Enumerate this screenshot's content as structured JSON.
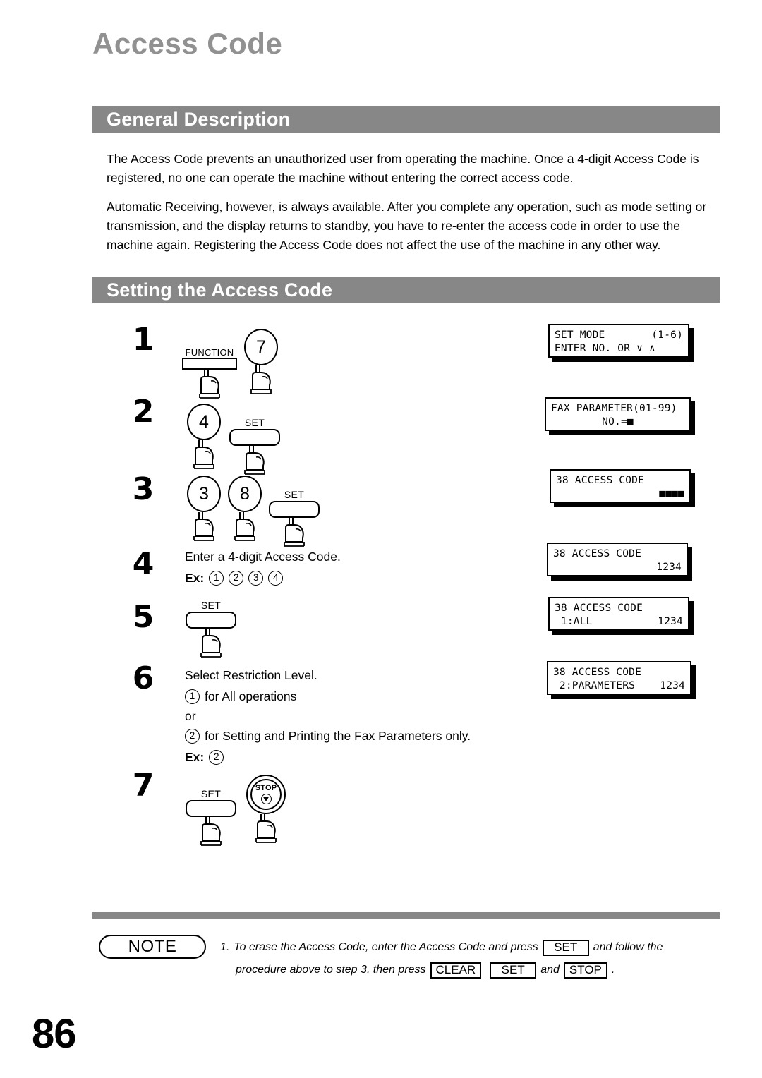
{
  "page": {
    "title": "Access Code",
    "number": "86"
  },
  "sections": {
    "general": {
      "heading": "General Description",
      "paragraph1": "The Access Code prevents an unauthorized user from operating the machine.  Once a 4-digit Access Code is registered, no one can operate the machine without entering the correct access code.",
      "paragraph2": "Automatic Receiving, however, is always available.  After you complete any operation, such as mode setting or transmission, and the display returns to standby, you have to re-enter the access code in order to use the machine again.  Registering the Access Code does not affect the use of the machine in any other way."
    },
    "setting": {
      "heading": "Setting the Access Code"
    }
  },
  "steps": [
    {
      "number": "1",
      "keys": [
        {
          "type": "flat",
          "label": "FUNCTION"
        },
        {
          "type": "circle",
          "label": "7"
        }
      ],
      "lcd": {
        "line1_left": "SET MODE",
        "line1_right": "(1-6)",
        "line2_left": "ENTER NO. OR ∨ ∧",
        "line2_right": ""
      }
    },
    {
      "number": "2",
      "keys": [
        {
          "type": "circle",
          "label": "4"
        },
        {
          "type": "set",
          "label": "SET"
        }
      ],
      "lcd": {
        "line1_left": "FAX PARAMETER(01-99)",
        "line1_right": "",
        "line2_center": "NO.=■"
      }
    },
    {
      "number": "3",
      "keys": [
        {
          "type": "circle",
          "label": "3"
        },
        {
          "type": "circle",
          "label": "8"
        },
        {
          "type": "set",
          "label": "SET"
        }
      ],
      "lcd": {
        "line1_left": "38 ACCESS CODE",
        "line1_right": "",
        "line2_right": "■■■■"
      }
    },
    {
      "number": "4",
      "instruction": "Enter a 4-digit Access Code.",
      "example_label": "Ex:",
      "example_digits": [
        "1",
        "2",
        "3",
        "4"
      ],
      "lcd": {
        "line1_left": "38 ACCESS CODE",
        "line1_right": "",
        "line2_right": "1234"
      }
    },
    {
      "number": "5",
      "keys": [
        {
          "type": "set",
          "label": "SET"
        }
      ],
      "lcd": {
        "line1_left": "38 ACCESS CODE",
        "line1_right": "",
        "line2_left": " 1:ALL",
        "line2_right": "1234"
      }
    },
    {
      "number": "6",
      "instruction": "Select Restriction Level.",
      "option1_digit": "1",
      "option1_text": "for All operations",
      "or_text": "or",
      "option2_digit": "2",
      "option2_text": "for Setting and Printing the Fax Parameters only.",
      "example_label": "Ex:",
      "example_digits": [
        "2"
      ],
      "lcd": {
        "line1_left": "38 ACCESS CODE",
        "line1_right": "",
        "line2_left": " 2:PARAMETERS",
        "line2_right": "1234"
      }
    },
    {
      "number": "7",
      "keys": [
        {
          "type": "set",
          "label": "SET"
        },
        {
          "type": "stop",
          "label": "STOP"
        }
      ]
    }
  ],
  "note": {
    "badge": "NOTE",
    "item_number": "1.",
    "line1_part1": "To erase the Access Code, enter the Access Code and press",
    "line1_key": "SET",
    "line1_part2": "and follow the",
    "line2_part1": "procedure above to step 3, then press",
    "line2_key1": "CLEAR",
    "line2_key2": "SET",
    "line2_conj": "and",
    "line2_key3": "STOP",
    "line2_end": "."
  },
  "colors": {
    "title_gray": "#919191",
    "bar_gray": "#878787",
    "text_black": "#000000"
  }
}
